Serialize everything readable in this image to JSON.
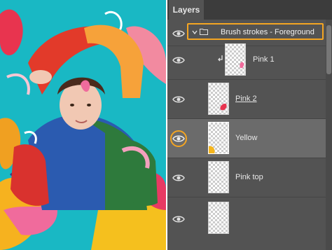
{
  "panel": {
    "tab_label": "Layers",
    "group": {
      "name": "Brush strokes - Foreground"
    },
    "layers": [
      {
        "name": "Pink 1"
      },
      {
        "name": "Pink 2"
      },
      {
        "name": "Yellow"
      },
      {
        "name": "Pink top"
      }
    ]
  },
  "colors": {
    "highlight": "#f4a522",
    "panel_bg": "#535353",
    "selected_row": "#6b6b6b",
    "photo_bg": "#19b8c4"
  }
}
